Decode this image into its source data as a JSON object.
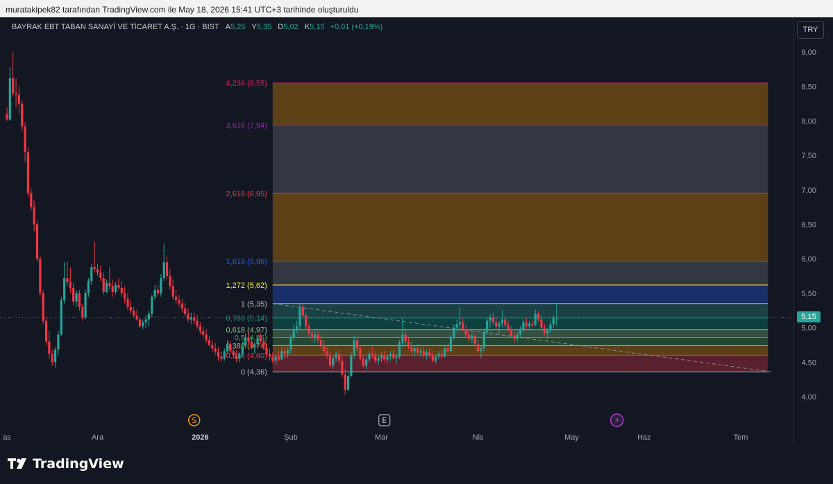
{
  "caption": "muratakipek82 tarafından TradingView.com ile May 18, 2026 15:41 UTC+3 tarihinde oluşturuldu",
  "legend": {
    "symbol": "BAYRAK EBT TABAN SANAYİ VE TİCARET A.Ş. · 1G · BIST",
    "open_key": "A",
    "open_val": "5,25",
    "high_key": "Y",
    "high_val": "5,35",
    "low_key": "D",
    "low_val": "5,02",
    "close_key": "K",
    "close_val": "5,15",
    "change": "+0,01 (+0,19%)"
  },
  "currency": "TRY",
  "last_price_label": "5,15",
  "footer": {
    "brand": "TradingView"
  },
  "colors": {
    "background": "#131722",
    "up": "#26a69a",
    "down": "#f23645",
    "axis_text": "#a3a6af",
    "grid": "#1e222d"
  },
  "chart_data": {
    "type": "candlestick",
    "ylim": [
      3.8,
      9.1
    ],
    "y_ticks": [
      {
        "v": 4.0,
        "label": "4,00"
      },
      {
        "v": 4.5,
        "label": "4,50"
      },
      {
        "v": 5.0,
        "label": "5,00"
      },
      {
        "v": 5.5,
        "label": "5,50"
      },
      {
        "v": 6.0,
        "label": "6,00"
      },
      {
        "v": 6.5,
        "label": "6,50"
      },
      {
        "v": 7.0,
        "label": "7,00"
      },
      {
        "v": 7.5,
        "label": "7,50"
      },
      {
        "v": 8.0,
        "label": "8,00"
      },
      {
        "v": 8.5,
        "label": "8,50"
      },
      {
        "v": 9.0,
        "label": "9,00"
      }
    ],
    "x_ticks": [
      {
        "i": 0,
        "label": "as",
        "bold": false
      },
      {
        "i": 30,
        "label": "Ara",
        "bold": false
      },
      {
        "i": 64,
        "label": "2026",
        "bold": true
      },
      {
        "i": 94,
        "label": "Şub",
        "bold": false
      },
      {
        "i": 124,
        "label": "Mar",
        "bold": false
      },
      {
        "i": 156,
        "label": "Nis",
        "bold": false
      },
      {
        "i": 187,
        "label": "May",
        "bold": false
      },
      {
        "i": 211,
        "label": "Haz",
        "bold": false
      },
      {
        "i": 243,
        "label": "Tem",
        "bold": false
      }
    ],
    "event_markers": [
      {
        "i": 62,
        "glyph": "S",
        "kind": "split"
      },
      {
        "i": 125,
        "glyph": "E",
        "kind": "earnings"
      },
      {
        "i": 202,
        "glyph": "⚡",
        "kind": "news"
      }
    ],
    "fib_levels": [
      {
        "ratio": "0",
        "price": "4,36",
        "v": 4.36,
        "color": "#b2b5be"
      },
      {
        "ratio": "0,236",
        "price": "4,60",
        "v": 4.6,
        "color": "#f23645"
      },
      {
        "ratio": "0,382",
        "price": "4,74",
        "v": 4.74,
        "color": "#ff9800"
      },
      {
        "ratio": "0,5",
        "price": "4,86",
        "v": 4.86,
        "color": "#4caf50"
      },
      {
        "ratio": "0,618",
        "price": "4,97",
        "v": 4.97,
        "color": "#81c784"
      },
      {
        "ratio": "0,786",
        "price": "5,14",
        "v": 5.14,
        "color": "#089981"
      },
      {
        "ratio": "1",
        "price": "5,35",
        "v": 5.35,
        "color": "#b2b5be"
      },
      {
        "ratio": "1,272",
        "price": "5,62",
        "v": 5.62,
        "color": "#ffeb3b"
      },
      {
        "ratio": "1,618",
        "price": "5,96",
        "v": 5.96,
        "color": "#2962ff"
      },
      {
        "ratio": "2,618",
        "price": "6,95",
        "v": 6.95,
        "color": "#f23645"
      },
      {
        "ratio": "3,618",
        "price": "7,94",
        "v": 7.94,
        "color": "#9c27b0"
      },
      {
        "ratio": "4,236",
        "price": "8,55",
        "v": 8.55,
        "color": "#e91e63"
      }
    ],
    "fib_fills": [
      "#f23645",
      "#ff9800",
      "#4caf50",
      "#81c784",
      "#089981",
      "#2a9d8f",
      "#2962ff",
      "#787b86",
      "#ff9800",
      "#787b86",
      "#ff9800"
    ],
    "fib_start_index": 88,
    "fib_end_index": 252,
    "trendline": {
      "i1": 88,
      "v1": 5.35,
      "i2": 253,
      "v2": 4.36
    },
    "last_price": 5.15,
    "candles": [
      [
        8.1,
        8.2,
        8.0,
        8.02
      ],
      [
        8.02,
        8.78,
        8.0,
        8.62
      ],
      [
        8.62,
        9.0,
        8.35,
        8.4
      ],
      [
        8.4,
        8.62,
        8.2,
        8.38
      ],
      [
        8.38,
        8.5,
        8.1,
        8.25
      ],
      [
        8.25,
        8.3,
        7.85,
        7.92
      ],
      [
        7.92,
        7.98,
        7.4,
        7.55
      ],
      [
        7.55,
        7.62,
        6.9,
        6.95
      ],
      [
        6.95,
        7.02,
        6.7,
        6.75
      ],
      [
        6.75,
        6.85,
        6.4,
        6.5
      ],
      [
        6.5,
        6.55,
        5.95,
        6.0
      ],
      [
        6.0,
        6.05,
        5.45,
        5.5
      ],
      [
        5.5,
        5.55,
        5.05,
        5.1
      ],
      [
        5.1,
        5.15,
        4.75,
        4.8
      ],
      [
        4.8,
        4.95,
        4.55,
        4.62
      ],
      [
        4.62,
        4.68,
        4.45,
        4.5
      ],
      [
        4.5,
        4.72,
        4.42,
        4.68
      ],
      [
        4.68,
        4.95,
        4.6,
        4.9
      ],
      [
        4.9,
        5.45,
        4.88,
        5.4
      ],
      [
        5.4,
        5.95,
        5.35,
        5.72
      ],
      [
        5.72,
        5.96,
        5.6,
        5.66
      ],
      [
        5.66,
        5.88,
        5.5,
        5.58
      ],
      [
        5.58,
        5.65,
        5.32,
        5.38
      ],
      [
        5.38,
        5.55,
        5.3,
        5.5
      ],
      [
        5.5,
        5.55,
        5.25,
        5.3
      ],
      [
        5.3,
        5.35,
        5.1,
        5.15
      ],
      [
        5.15,
        5.55,
        5.12,
        5.5
      ],
      [
        5.5,
        5.72,
        5.45,
        5.68
      ],
      [
        5.68,
        5.92,
        5.62,
        5.88
      ],
      [
        5.88,
        6.25,
        5.8,
        5.85
      ],
      [
        5.85,
        5.92,
        5.75,
        5.8
      ],
      [
        5.8,
        5.9,
        5.68,
        5.72
      ],
      [
        5.72,
        5.8,
        5.48,
        5.52
      ],
      [
        5.52,
        5.7,
        5.5,
        5.65
      ],
      [
        5.65,
        5.88,
        5.55,
        5.6
      ],
      [
        5.6,
        5.7,
        5.45,
        5.52
      ],
      [
        5.52,
        5.66,
        5.48,
        5.62
      ],
      [
        5.62,
        5.72,
        5.55,
        5.58
      ],
      [
        5.58,
        5.68,
        5.45,
        5.5
      ],
      [
        5.5,
        5.6,
        5.35,
        5.42
      ],
      [
        5.42,
        5.5,
        5.25,
        5.3
      ],
      [
        5.3,
        5.4,
        5.2,
        5.25
      ],
      [
        5.25,
        5.3,
        5.15,
        5.18
      ],
      [
        5.18,
        5.26,
        5.1,
        5.12
      ],
      [
        5.12,
        5.15,
        5.0,
        5.02
      ],
      [
        5.02,
        5.12,
        4.98,
        5.08
      ],
      [
        5.08,
        5.18,
        5.0,
        5.12
      ],
      [
        5.12,
        5.25,
        5.02,
        5.2
      ],
      [
        5.2,
        5.48,
        5.15,
        5.45
      ],
      [
        5.45,
        5.62,
        5.4,
        5.55
      ],
      [
        5.55,
        5.62,
        5.45,
        5.5
      ],
      [
        5.5,
        5.78,
        5.45,
        5.72
      ],
      [
        5.72,
        6.22,
        5.68,
        5.95
      ],
      [
        5.95,
        6.05,
        5.7,
        5.75
      ],
      [
        5.75,
        5.85,
        5.55,
        5.6
      ],
      [
        5.6,
        5.7,
        5.4,
        5.45
      ],
      [
        5.45,
        5.55,
        5.35,
        5.4
      ],
      [
        5.4,
        5.48,
        5.3,
        5.35
      ],
      [
        5.35,
        5.42,
        5.22,
        5.28
      ],
      [
        5.28,
        5.36,
        5.15,
        5.2
      ],
      [
        5.2,
        5.28,
        5.08,
        5.12
      ],
      [
        5.12,
        5.22,
        5.05,
        5.15
      ],
      [
        5.15,
        5.22,
        5.05,
        5.1
      ],
      [
        5.1,
        5.18,
        4.98,
        5.02
      ],
      [
        5.02,
        5.08,
        4.9,
        4.95
      ],
      [
        4.95,
        5.02,
        4.85,
        4.9
      ],
      [
        4.9,
        4.98,
        4.78,
        4.82
      ],
      [
        4.82,
        4.88,
        4.72,
        4.75
      ],
      [
        4.75,
        4.82,
        4.65,
        4.7
      ],
      [
        4.7,
        4.78,
        4.6,
        4.65
      ],
      [
        4.65,
        4.72,
        4.52,
        4.58
      ],
      [
        4.58,
        4.65,
        4.5,
        4.55
      ],
      [
        4.55,
        4.7,
        4.52,
        4.66
      ],
      [
        4.66,
        4.82,
        4.62,
        4.76
      ],
      [
        4.76,
        4.8,
        4.62,
        4.66
      ],
      [
        4.66,
        4.72,
        4.55,
        4.6
      ],
      [
        4.6,
        4.68,
        4.5,
        4.55
      ],
      [
        4.55,
        4.65,
        4.5,
        4.62
      ],
      [
        4.62,
        4.8,
        4.58,
        4.74
      ],
      [
        4.74,
        4.92,
        4.7,
        4.86
      ],
      [
        4.86,
        4.95,
        4.75,
        4.8
      ],
      [
        4.8,
        4.88,
        4.68,
        4.72
      ],
      [
        4.72,
        4.8,
        4.62,
        4.76
      ],
      [
        4.76,
        4.88,
        4.72,
        4.84
      ],
      [
        4.84,
        4.92,
        4.78,
        4.8
      ],
      [
        4.8,
        4.84,
        4.68,
        4.7
      ],
      [
        4.7,
        4.78,
        4.6,
        4.62
      ],
      [
        4.62,
        4.7,
        4.52,
        4.58
      ],
      [
        4.58,
        4.64,
        4.48,
        4.52
      ],
      [
        4.52,
        4.62,
        4.46,
        4.58
      ],
      [
        4.58,
        4.66,
        4.5,
        4.54
      ],
      [
        4.54,
        4.72,
        4.52,
        4.66
      ],
      [
        4.66,
        4.72,
        4.55,
        4.62
      ],
      [
        4.62,
        4.72,
        4.56,
        4.68
      ],
      [
        4.68,
        4.9,
        4.62,
        4.86
      ],
      [
        4.86,
        5.05,
        4.8,
        4.98
      ],
      [
        4.98,
        5.1,
        4.92,
        5.02
      ],
      [
        5.02,
        5.34,
        4.98,
        5.3
      ],
      [
        5.3,
        5.35,
        5.15,
        5.18
      ],
      [
        5.18,
        5.22,
        4.98,
        5.02
      ],
      [
        5.02,
        5.08,
        4.88,
        4.92
      ],
      [
        4.92,
        4.98,
        4.8,
        4.85
      ],
      [
        4.85,
        4.95,
        4.78,
        4.9
      ],
      [
        4.9,
        4.96,
        4.78,
        4.82
      ],
      [
        4.82,
        4.9,
        4.7,
        4.75
      ],
      [
        4.75,
        4.82,
        4.62,
        4.66
      ],
      [
        4.66,
        4.72,
        4.55,
        4.6
      ],
      [
        4.6,
        4.65,
        4.42,
        4.45
      ],
      [
        4.45,
        4.6,
        4.4,
        4.56
      ],
      [
        4.56,
        4.66,
        4.5,
        4.62
      ],
      [
        4.62,
        4.68,
        4.48,
        4.52
      ],
      [
        4.52,
        4.6,
        4.28,
        4.32
      ],
      [
        4.32,
        4.4,
        4.02,
        4.1
      ],
      [
        4.1,
        4.35,
        4.08,
        4.3
      ],
      [
        4.3,
        4.65,
        4.28,
        4.6
      ],
      [
        4.6,
        4.88,
        4.55,
        4.82
      ],
      [
        4.82,
        4.86,
        4.66,
        4.7
      ],
      [
        4.7,
        4.74,
        4.52,
        4.55
      ],
      [
        4.55,
        4.62,
        4.42,
        4.45
      ],
      [
        4.45,
        4.58,
        4.4,
        4.54
      ],
      [
        4.54,
        4.66,
        4.5,
        4.62
      ],
      [
        4.62,
        4.72,
        4.55,
        4.6
      ],
      [
        4.6,
        4.66,
        4.48,
        4.52
      ],
      [
        4.52,
        4.6,
        4.46,
        4.56
      ],
      [
        4.56,
        4.64,
        4.5,
        4.6
      ],
      [
        4.6,
        4.66,
        4.5,
        4.54
      ],
      [
        4.54,
        4.62,
        4.48,
        4.58
      ],
      [
        4.58,
        4.66,
        4.52,
        4.62
      ],
      [
        4.62,
        4.68,
        4.54,
        4.56
      ],
      [
        4.56,
        4.62,
        4.48,
        4.58
      ],
      [
        4.58,
        4.82,
        4.55,
        4.78
      ],
      [
        4.78,
        5.15,
        4.72,
        4.9
      ],
      [
        4.9,
        4.96,
        4.75,
        4.8
      ],
      [
        4.8,
        4.86,
        4.68,
        4.72
      ],
      [
        4.72,
        4.8,
        4.62,
        4.66
      ],
      [
        4.66,
        4.74,
        4.58,
        4.7
      ],
      [
        4.7,
        4.76,
        4.62,
        4.64
      ],
      [
        4.64,
        4.7,
        4.58,
        4.66
      ],
      [
        4.66,
        4.72,
        4.56,
        4.6
      ],
      [
        4.6,
        4.68,
        4.54,
        4.64
      ],
      [
        4.64,
        4.7,
        4.56,
        4.6
      ],
      [
        4.6,
        4.66,
        4.5,
        4.52
      ],
      [
        4.52,
        4.62,
        4.48,
        4.58
      ],
      [
        4.58,
        4.66,
        4.54,
        4.62
      ],
      [
        4.62,
        4.68,
        4.55,
        4.58
      ],
      [
        4.58,
        4.74,
        4.56,
        4.7
      ],
      [
        4.7,
        4.78,
        4.64,
        4.66
      ],
      [
        4.66,
        4.9,
        4.64,
        4.86
      ],
      [
        4.86,
        5.05,
        4.82,
        5.0
      ],
      [
        5.0,
        5.12,
        4.95,
        5.05
      ],
      [
        5.05,
        5.3,
        5.0,
        5.08
      ],
      [
        5.08,
        5.14,
        4.95,
        4.98
      ],
      [
        4.98,
        5.04,
        4.86,
        4.9
      ],
      [
        4.9,
        4.96,
        4.8,
        4.84
      ],
      [
        4.84,
        4.92,
        4.78,
        4.88
      ],
      [
        4.88,
        4.94,
        4.72,
        4.76
      ],
      [
        4.76,
        4.82,
        4.62,
        4.66
      ],
      [
        4.66,
        4.74,
        4.56,
        4.7
      ],
      [
        4.7,
        4.98,
        4.66,
        4.94
      ],
      [
        4.94,
        5.15,
        4.9,
        5.1
      ],
      [
        5.1,
        5.2,
        5.0,
        5.15
      ],
      [
        5.15,
        5.22,
        5.04,
        5.08
      ],
      [
        5.08,
        5.14,
        4.98,
        5.02
      ],
      [
        5.02,
        5.1,
        4.92,
        5.06
      ],
      [
        5.06,
        5.26,
        5.0,
        5.12
      ],
      [
        5.12,
        5.18,
        5.0,
        5.04
      ],
      [
        5.04,
        5.1,
        4.95,
        4.98
      ],
      [
        4.98,
        5.02,
        4.85,
        4.88
      ],
      [
        4.88,
        4.94,
        4.78,
        4.84
      ],
      [
        4.84,
        4.94,
        4.8,
        4.9
      ],
      [
        4.9,
        5.02,
        4.86,
        4.98
      ],
      [
        4.98,
        5.12,
        4.94,
        5.08
      ],
      [
        5.08,
        5.14,
        4.98,
        5.02
      ],
      [
        5.02,
        5.1,
        4.96,
        5.06
      ],
      [
        5.06,
        5.12,
        5.0,
        5.04
      ],
      [
        5.04,
        5.26,
        5.02,
        5.2
      ],
      [
        5.2,
        5.24,
        5.08,
        5.12
      ],
      [
        5.12,
        5.18,
        4.96,
        5.0
      ],
      [
        5.0,
        5.06,
        4.88,
        4.92
      ],
      [
        4.92,
        5.0,
        4.84,
        4.96
      ],
      [
        4.96,
        5.1,
        4.92,
        5.05
      ],
      [
        5.05,
        5.18,
        5.0,
        5.14
      ],
      [
        5.14,
        5.35,
        5.02,
        5.15
      ]
    ]
  }
}
